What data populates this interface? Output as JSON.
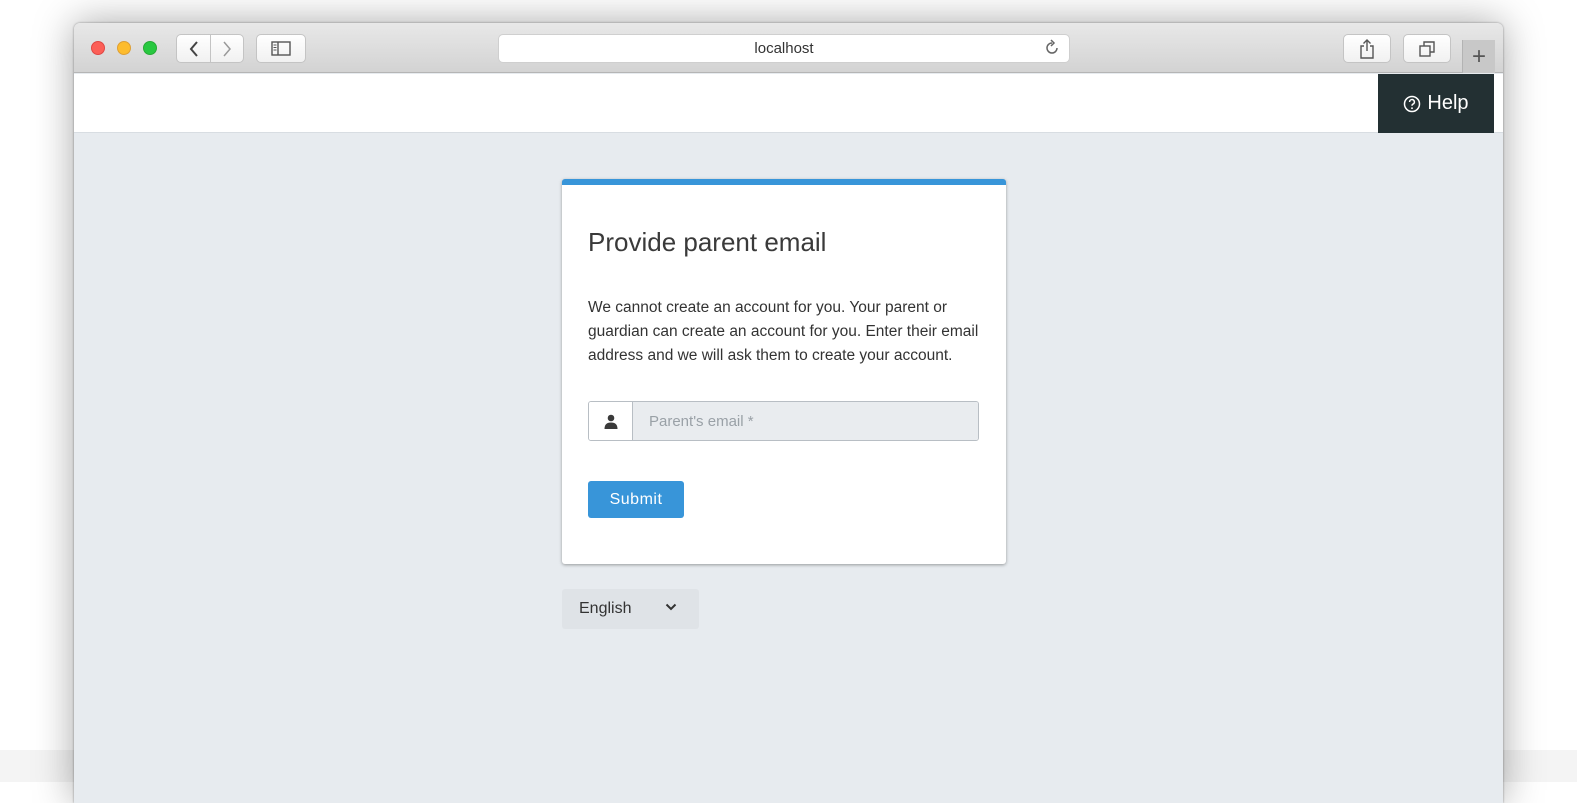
{
  "browser": {
    "url": "localhost",
    "new_tab_symbol": "+"
  },
  "header": {
    "help_label": "Help"
  },
  "card": {
    "title": "Provide parent email",
    "description": "We cannot create an account for you. Your parent or guardian can create an account for you. Enter their email address and we will ask them to create your account.",
    "email_placeholder": "Parent's email *",
    "email_value": "",
    "submit_label": "Submit"
  },
  "language": {
    "selected": "English"
  },
  "icons": {
    "help": "question-circle-icon",
    "user": "user-icon",
    "chevron": "chevron-down-icon"
  },
  "colors": {
    "accent": "#3895d9",
    "help_bg": "#233033",
    "page_bg": "#e7ebef"
  }
}
